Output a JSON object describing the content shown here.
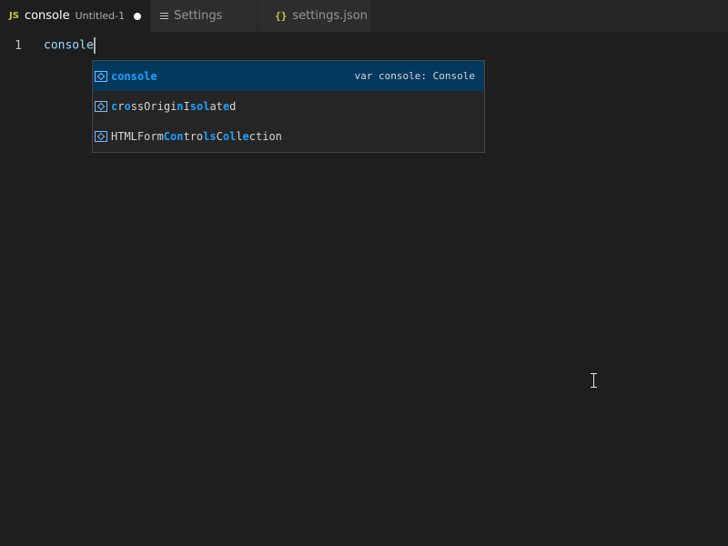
{
  "tabs": [
    {
      "icon": "js-icon",
      "icon_text": "JS",
      "title": "console",
      "description": "Untitled-1",
      "active": true,
      "dirty": true
    },
    {
      "icon": "settings-icon",
      "title": "Settings",
      "active": false
    },
    {
      "icon": "json-braces-icon",
      "icon_text": "{}",
      "title": "settings.json",
      "active": false
    }
  ],
  "editor": {
    "line_number": "1",
    "code": "console"
  },
  "suggest": {
    "items": [
      {
        "icon": "variable-icon",
        "label_segments": [
          {
            "t": "console",
            "h": true
          }
        ],
        "detail": "var console: Console",
        "selected": true
      },
      {
        "icon": "variable-icon",
        "label_segments": [
          {
            "t": "c",
            "h": true
          },
          {
            "t": "r",
            "h": false
          },
          {
            "t": "o",
            "h": true
          },
          {
            "t": "ss",
            "h": false
          },
          {
            "t": "O",
            "h": false
          },
          {
            "t": "rigi",
            "h": false
          },
          {
            "t": "n",
            "h": true
          },
          {
            "t": "I",
            "h": false
          },
          {
            "t": "so",
            "h": true
          },
          {
            "t": "l",
            "h": true
          },
          {
            "t": "at",
            "h": false
          },
          {
            "t": "e",
            "h": true
          },
          {
            "t": "d",
            "h": false
          }
        ],
        "detail": "",
        "selected": false
      },
      {
        "icon": "variable-icon",
        "label_segments": [
          {
            "t": "HTMLForm",
            "h": false
          },
          {
            "t": "Con",
            "h": true
          },
          {
            "t": "tro",
            "h": false
          },
          {
            "t": "ls",
            "h": true
          },
          {
            "t": "C",
            "h": false
          },
          {
            "t": "ol",
            "h": true
          },
          {
            "t": "l",
            "h": false
          },
          {
            "t": "e",
            "h": true
          },
          {
            "t": "ction",
            "h": false
          }
        ],
        "detail": "",
        "selected": false
      }
    ]
  },
  "colors": {
    "editor_bg": "#1e1e1e",
    "tabbar_bg": "#252526",
    "selection_bg": "#04395e",
    "highlight": "#18a3ff",
    "js_icon": "#cbcb41"
  }
}
